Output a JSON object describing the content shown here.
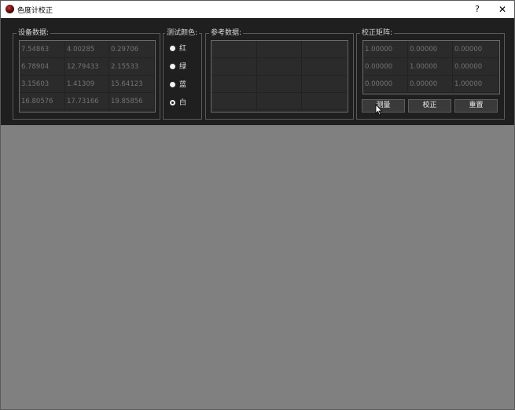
{
  "window": {
    "title": "色度计校正",
    "help_label": "?",
    "close_label": "✕"
  },
  "device_data": {
    "title": "设备数据:",
    "rows": [
      [
        "7.54863",
        "4.00285",
        "0.29706"
      ],
      [
        "6.78904",
        "12.79433",
        "2.15533"
      ],
      [
        "3.15603",
        "1.41309",
        "15.64123"
      ],
      [
        "16.80576",
        "17.73166",
        "19.85856"
      ]
    ]
  },
  "test_color": {
    "title": "测试颜色:",
    "options": [
      "红",
      "绿",
      "蓝",
      "白"
    ],
    "selected": "白"
  },
  "reference_data": {
    "title": "参考数据:",
    "rows": [
      [
        "",
        "",
        ""
      ],
      [
        "",
        "",
        ""
      ],
      [
        "",
        "",
        ""
      ],
      [
        "",
        "",
        ""
      ]
    ]
  },
  "correction_matrix": {
    "title": "校正矩阵:",
    "rows": [
      [
        "1.00000",
        "0.00000",
        "0.00000"
      ],
      [
        "0.00000",
        "1.00000",
        "0.00000"
      ],
      [
        "0.00000",
        "0.00000",
        "1.00000"
      ]
    ]
  },
  "buttons": {
    "measure": "测量",
    "correct": "校正",
    "reset": "重置"
  },
  "colors": {
    "panel_bg": "#1f1f1f",
    "canvas_bg": "#808080",
    "border": "#5a5a5a"
  }
}
